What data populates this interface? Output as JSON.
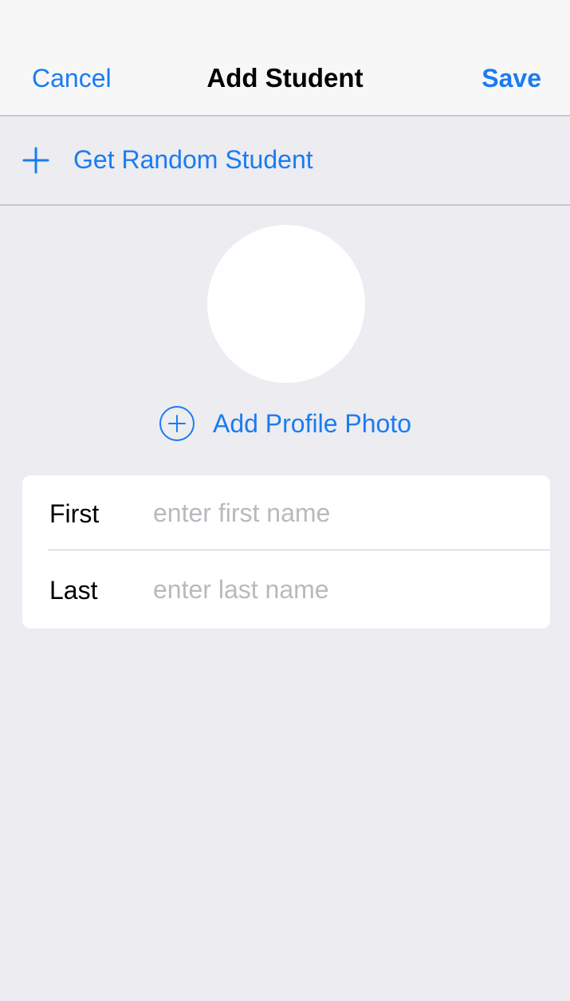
{
  "nav": {
    "cancel_label": "Cancel",
    "title": "Add Student",
    "save_label": "Save"
  },
  "random": {
    "label": "Get Random Student",
    "icon": "plus-icon"
  },
  "profile": {
    "add_photo_label": "Add Profile Photo",
    "icon": "circle-plus-icon"
  },
  "form": {
    "first": {
      "label": "First",
      "value": "",
      "placeholder": "enter first name"
    },
    "last": {
      "label": "Last",
      "value": "",
      "placeholder": "enter last name"
    }
  },
  "colors": {
    "accent": "#1a7cf2",
    "background": "#ececf1",
    "nav_background": "#f7f7f8",
    "separator": "#c8c7cc",
    "placeholder": "#b9b9bf"
  }
}
